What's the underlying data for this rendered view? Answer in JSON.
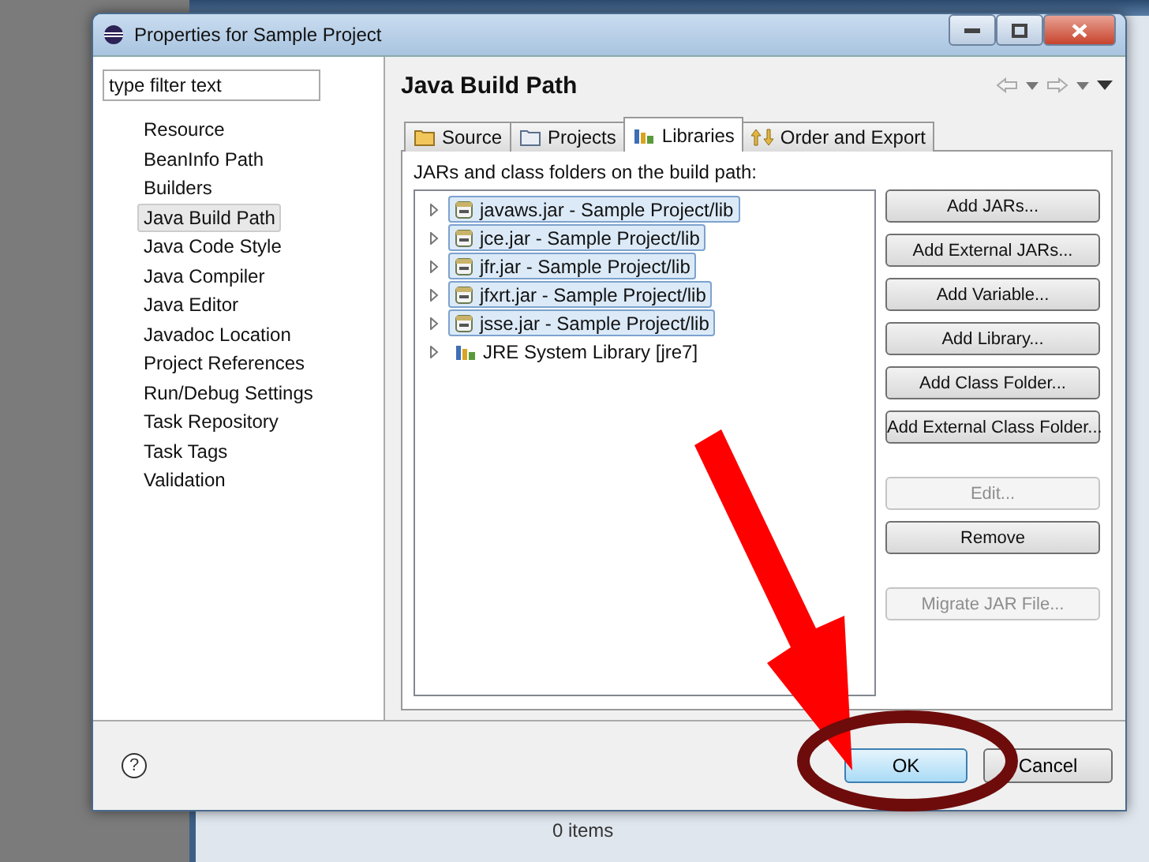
{
  "window": {
    "title": "Properties for Sample Project"
  },
  "filter": {
    "placeholder": "type filter text"
  },
  "sidebar": {
    "items": [
      {
        "label": "Resource",
        "selected": false
      },
      {
        "label": "BeanInfo Path",
        "selected": false
      },
      {
        "label": "Builders",
        "selected": false
      },
      {
        "label": "Java Build Path",
        "selected": true
      },
      {
        "label": "Java Code Style",
        "selected": false
      },
      {
        "label": "Java Compiler",
        "selected": false
      },
      {
        "label": "Java Editor",
        "selected": false
      },
      {
        "label": "Javadoc Location",
        "selected": false
      },
      {
        "label": "Project References",
        "selected": false
      },
      {
        "label": "Run/Debug Settings",
        "selected": false
      },
      {
        "label": "Task Repository",
        "selected": false
      },
      {
        "label": "Task Tags",
        "selected": false
      },
      {
        "label": "Validation",
        "selected": false
      }
    ]
  },
  "page": {
    "title": "Java Build Path"
  },
  "tabs": [
    {
      "label": "Source",
      "selected": false
    },
    {
      "label": "Projects",
      "selected": false
    },
    {
      "label": "Libraries",
      "selected": true
    },
    {
      "label": "Order and Export",
      "selected": false
    }
  ],
  "libraries": {
    "caption": "JARs and class folders on the build path:",
    "items": [
      {
        "label": "javaws.jar - Sample Project/lib",
        "kind": "jar",
        "selected": true
      },
      {
        "label": "jce.jar - Sample Project/lib",
        "kind": "jar",
        "selected": true
      },
      {
        "label": "jfr.jar - Sample Project/lib",
        "kind": "jar",
        "selected": true
      },
      {
        "label": "jfxrt.jar - Sample Project/lib",
        "kind": "jar",
        "selected": true
      },
      {
        "label": "jsse.jar - Sample Project/lib",
        "kind": "jar",
        "selected": true
      },
      {
        "label": "JRE System Library [jre7]",
        "kind": "library",
        "selected": false
      }
    ]
  },
  "side_button_groups": [
    [
      {
        "label": "Add JARs...",
        "disabled": false
      },
      {
        "label": "Add External JARs...",
        "disabled": false
      },
      {
        "label": "Add Variable...",
        "disabled": false
      },
      {
        "label": "Add Library...",
        "disabled": false
      },
      {
        "label": "Add Class Folder...",
        "disabled": false
      },
      {
        "label": "Add External Class Folder...",
        "disabled": false
      }
    ],
    [
      {
        "label": "Edit...",
        "disabled": true
      },
      {
        "label": "Remove",
        "disabled": false
      }
    ],
    [
      {
        "label": "Migrate JAR File...",
        "disabled": true
      }
    ]
  ],
  "footer": {
    "help": "?",
    "buttons": [
      {
        "label": "OK",
        "default": true
      },
      {
        "label": "Cancel",
        "default": false
      }
    ]
  },
  "background": {
    "status": "0 items"
  }
}
